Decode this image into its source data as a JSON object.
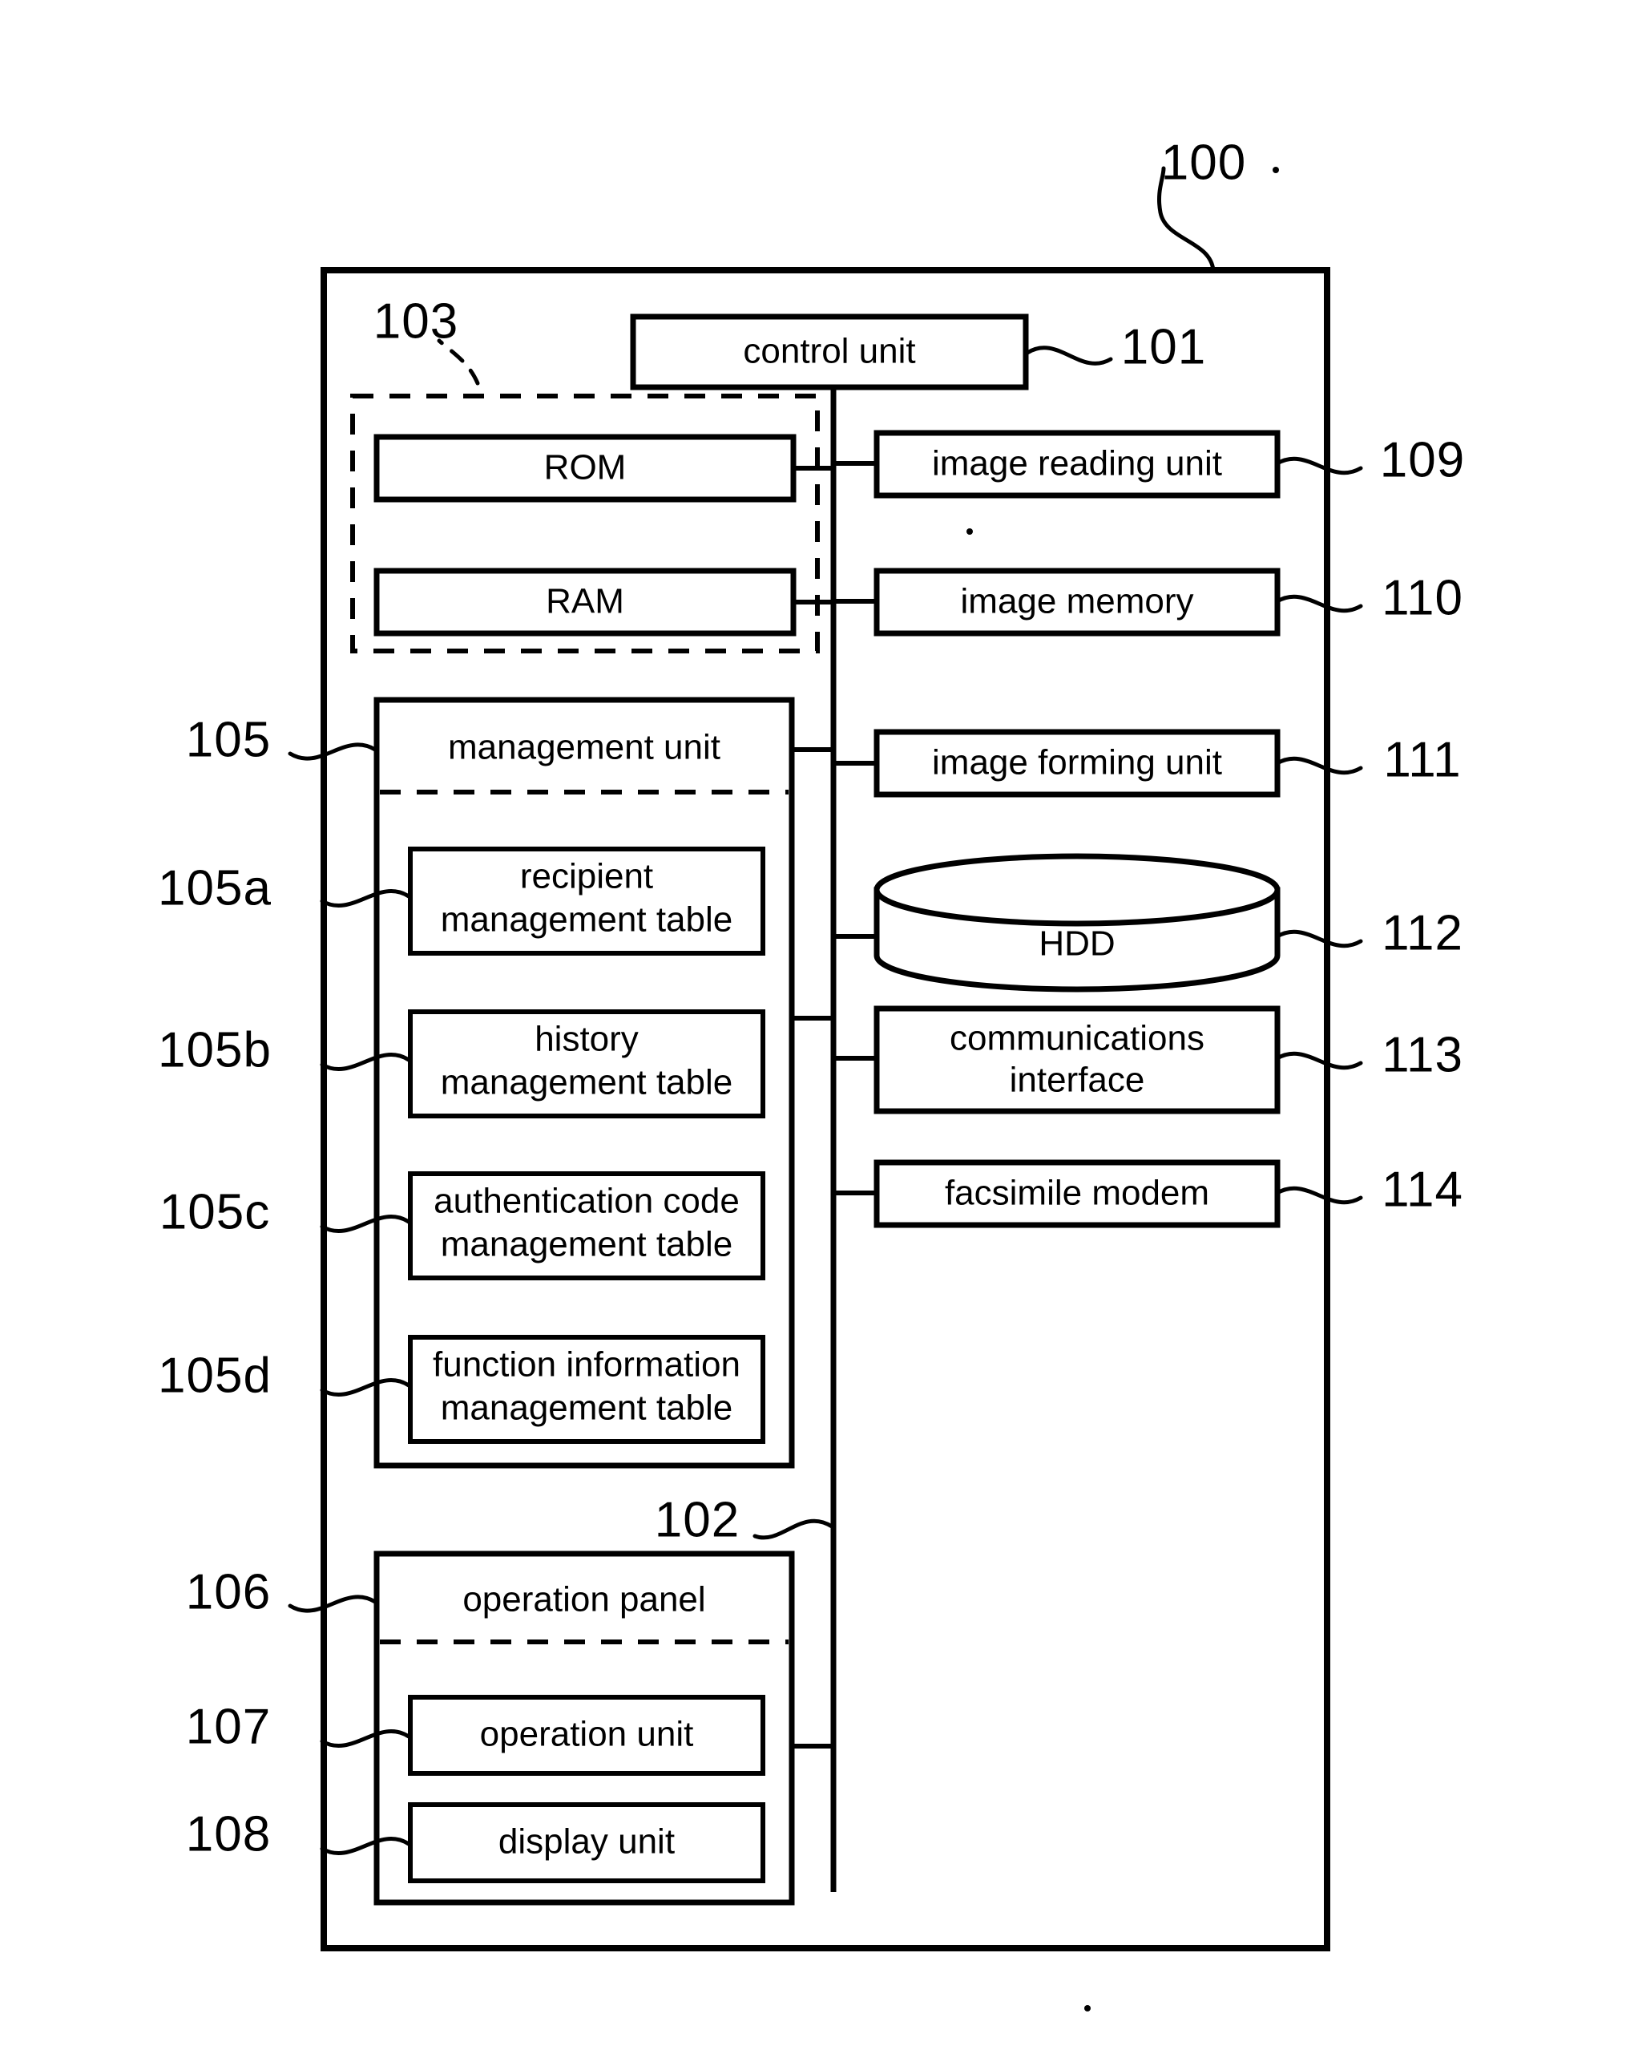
{
  "figure": {
    "type": "patent-block-diagram",
    "subject": "image forming apparatus block diagram",
    "outer_label": "100"
  },
  "blocks": {
    "control_unit": {
      "label": "control unit",
      "ref": "101"
    },
    "bus": {
      "ref": "102"
    },
    "memory_group": {
      "ref": "103"
    },
    "rom": {
      "label": "ROM"
    },
    "ram": {
      "label": "RAM"
    },
    "management_unit": {
      "label": "management unit",
      "ref": "105"
    },
    "recipient_table": {
      "line1": "recipient",
      "line2": "management table",
      "ref": "105a"
    },
    "history_table": {
      "line1": "history",
      "line2": "management table",
      "ref": "105b"
    },
    "auth_code_table": {
      "line1": "authentication code",
      "line2": "management table",
      "ref": "105c"
    },
    "function_info_table": {
      "line1": "function information",
      "line2": "management table",
      "ref": "105d"
    },
    "operation_panel": {
      "label": "operation panel",
      "ref": "106"
    },
    "operation_unit": {
      "label": "operation unit",
      "ref": "107"
    },
    "display_unit": {
      "label": "display unit",
      "ref": "108"
    },
    "image_reading_unit": {
      "label": "image reading unit",
      "ref": "109"
    },
    "image_memory": {
      "label": "image memory",
      "ref": "110"
    },
    "image_forming_unit": {
      "label": "image forming unit",
      "ref": "111"
    },
    "hdd": {
      "label": "HDD",
      "ref": "112"
    },
    "communications_interface": {
      "line1": "communications",
      "line2": "interface",
      "ref": "113"
    },
    "facsimile_modem": {
      "label": "facsimile modem",
      "ref": "114"
    }
  },
  "colors": {
    "ink": "#000000",
    "paper": "#ffffff"
  }
}
